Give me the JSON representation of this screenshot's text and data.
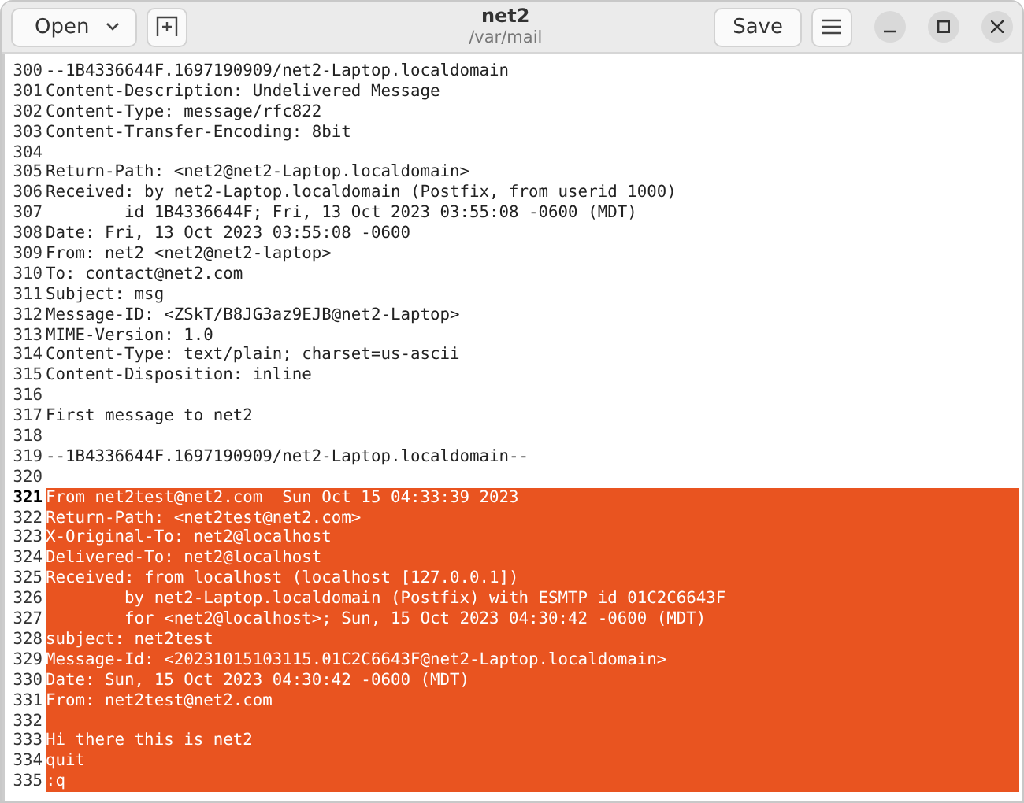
{
  "header": {
    "open_label": "Open",
    "title": "net2",
    "subtitle": "/var/mail",
    "save_label": "Save"
  },
  "lines": [
    {
      "number": "300",
      "text": "--1B4336644F.1697190909/net2-Laptop.localdomain",
      "selected": false,
      "current": false
    },
    {
      "number": "301",
      "text": "Content-Description: Undelivered Message",
      "selected": false,
      "current": false
    },
    {
      "number": "302",
      "text": "Content-Type: message/rfc822",
      "selected": false,
      "current": false
    },
    {
      "number": "303",
      "text": "Content-Transfer-Encoding: 8bit",
      "selected": false,
      "current": false
    },
    {
      "number": "304",
      "selected": false,
      "current": false
    },
    {
      "number": "305",
      "text": "Return-Path: <net2@net2-Laptop.localdomain>",
      "selected": false,
      "current": false
    },
    {
      "number": "306",
      "text": "Received: by net2-Laptop.localdomain (Postfix, from userid 1000)",
      "selected": false,
      "current": false
    },
    {
      "number": "307",
      "text": "        id 1B4336644F; Fri, 13 Oct 2023 03:55:08 -0600 (MDT)",
      "selected": false,
      "current": false
    },
    {
      "number": "308",
      "text": "Date: Fri, 13 Oct 2023 03:55:08 -0600",
      "selected": false,
      "current": false
    },
    {
      "number": "309",
      "text": "From: net2 <net2@net2-laptop>",
      "selected": false,
      "current": false
    },
    {
      "number": "310",
      "text": "To: contact@net2.com",
      "selected": false,
      "current": false
    },
    {
      "number": "311",
      "text": "Subject: msg",
      "selected": false,
      "current": false
    },
    {
      "number": "312",
      "text": "Message-ID: <ZSkT/B8JG3az9EJB@net2-Laptop>",
      "selected": false,
      "current": false
    },
    {
      "number": "313",
      "text": "MIME-Version: 1.0",
      "selected": false,
      "current": false
    },
    {
      "number": "314",
      "text": "Content-Type: text/plain; charset=us-ascii",
      "selected": false,
      "current": false
    },
    {
      "number": "315",
      "text": "Content-Disposition: inline",
      "selected": false,
      "current": false
    },
    {
      "number": "316",
      "selected": false,
      "current": false
    },
    {
      "number": "317",
      "text": "First message to net2",
      "selected": false,
      "current": false
    },
    {
      "number": "318",
      "selected": false,
      "current": false
    },
    {
      "number": "319",
      "text": "--1B4336644F.1697190909/net2-Laptop.localdomain--",
      "selected": false,
      "current": false
    },
    {
      "number": "320",
      "selected": false,
      "current": false
    },
    {
      "number": "321",
      "text": "From net2test@net2.com  Sun Oct 15 04:33:39 2023",
      "selected": true,
      "current": true
    },
    {
      "number": "322",
      "text": "Return-Path: <net2test@net2.com>",
      "selected": true,
      "current": false
    },
    {
      "number": "323",
      "text": "X-Original-To: net2@localhost",
      "selected": true,
      "current": false
    },
    {
      "number": "324",
      "text": "Delivered-To: net2@localhost",
      "selected": true,
      "current": false
    },
    {
      "number": "325",
      "text": "Received: from localhost (localhost [127.0.0.1])",
      "selected": true,
      "current": false
    },
    {
      "number": "326",
      "text": "        by net2-Laptop.localdomain (Postfix) with ESMTP id 01C2C6643F",
      "selected": true,
      "current": false
    },
    {
      "number": "327",
      "text": "        for <net2@localhost>; Sun, 15 Oct 2023 04:30:42 -0600 (MDT)",
      "selected": true,
      "current": false
    },
    {
      "number": "328",
      "text": "subject: net2test",
      "selected": true,
      "current": false
    },
    {
      "number": "329",
      "text": "Message-Id: <20231015103115.01C2C6643F@net2-Laptop.localdomain>",
      "selected": true,
      "current": false
    },
    {
      "number": "330",
      "text": "Date: Sun, 15 Oct 2023 04:30:42 -0600 (MDT)",
      "selected": true,
      "current": false
    },
    {
      "number": "331",
      "text": "From: net2test@net2.com",
      "selected": true,
      "current": false
    },
    {
      "number": "332",
      "selected": true,
      "current": false
    },
    {
      "number": "333",
      "text": "Hi there this is net2",
      "selected": true,
      "current": false
    },
    {
      "number": "334",
      "text": "quit",
      "selected": true,
      "current": false
    },
    {
      "number": "335",
      "text": ":q",
      "selected": true,
      "current": false
    }
  ]
}
